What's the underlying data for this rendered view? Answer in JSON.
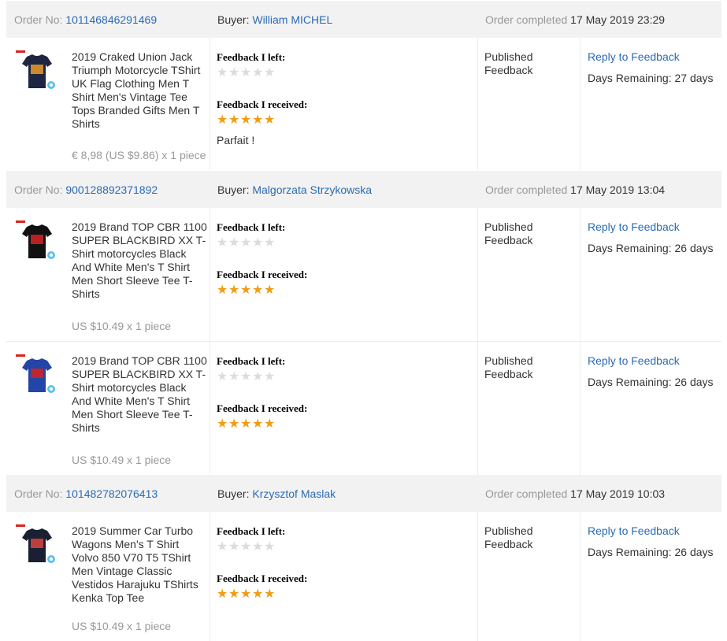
{
  "labels": {
    "order_no": "Order No:",
    "buyer": "Buyer:",
    "order_completed": "Order completed",
    "feedback_left": "Feedback I left:",
    "feedback_received": "Feedback I received:",
    "status": "Published Feedback",
    "reply": "Reply to Feedback"
  },
  "star_glyph": "★",
  "orders": [
    {
      "order_no": "101146846291469",
      "buyer": "William MICHEL",
      "completed": "17 May 2019 23:29",
      "items": [
        {
          "title": "2019 Craked Union Jack Triumph Motorcycle TShirt UK Flag Clothing Men T Shirt Men's Vintage Tee Tops Branded Gifts Men T Shirts",
          "price": "€ 8,98 (US $9.86) x 1 piece",
          "received_rating": 5,
          "comment": "Parfait !",
          "days": "Days Remaining: 27 days",
          "thumb_color": "#1e2540",
          "print_color": "#e0922a"
        }
      ]
    },
    {
      "order_no": "900128892371892",
      "buyer": "Malgorzata Strzykowska",
      "completed": "17 May 2019 13:04",
      "items": [
        {
          "title": "2019 Brand TOP CBR 1100 SUPER BLACKBIRD XX T-Shirt motorcycles Black And White Men's T Shirt Men Short Sleeve Tee T-Shirts",
          "price": "US $10.49 x 1 piece",
          "received_rating": 5,
          "comment": "",
          "days": "Days Remaining: 26 days",
          "thumb_color": "#111111",
          "print_color": "#cc2222"
        },
        {
          "title": "2019 Brand TOP CBR 1100 SUPER BLACKBIRD XX T-Shirt motorcycles Black And White Men's T Shirt Men Short Sleeve Tee T-Shirts",
          "price": "US $10.49 x 1 piece",
          "received_rating": 5,
          "comment": "",
          "days": "Days Remaining: 26 days",
          "thumb_color": "#2345a8",
          "print_color": "#cc2222"
        }
      ]
    },
    {
      "order_no": "101482782076413",
      "buyer": "Krzysztof Maslak",
      "completed": "17 May 2019 10:03",
      "items": [
        {
          "title": "2019 Summer Car Turbo Wagons Men's T Shirt Volvo 850 V70 T5 TShirt Men Vintage Classic Vestidos Harajuku TShirts Kenka Top Tee",
          "price": "US $10.49 x 1 piece",
          "received_rating": 5,
          "comment": "",
          "days": "Days Remaining: 26 days",
          "thumb_color": "#1a1f33",
          "print_color": "#d04040"
        }
      ]
    }
  ]
}
